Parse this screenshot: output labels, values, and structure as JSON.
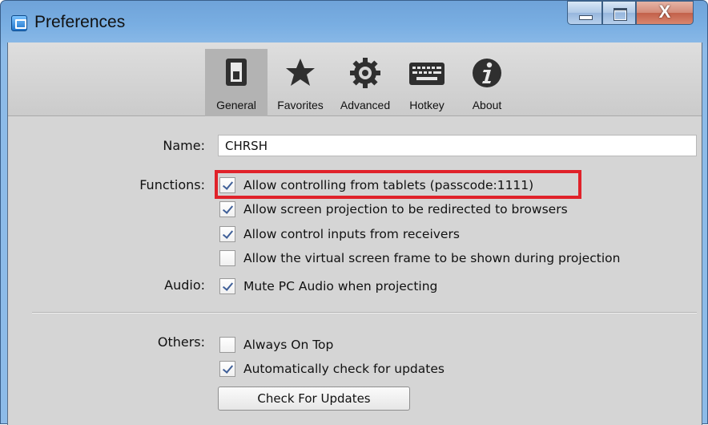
{
  "window": {
    "title": "Preferences",
    "close_glyph": "X"
  },
  "toolbar": {
    "items": [
      {
        "label": "General",
        "icon": "switch-icon",
        "active": true
      },
      {
        "label": "Favorites",
        "icon": "star-icon"
      },
      {
        "label": "Advanced",
        "icon": "gear-icon"
      },
      {
        "label": "Hotkey",
        "icon": "keyboard-icon"
      },
      {
        "label": "About",
        "icon": "info-icon"
      }
    ]
  },
  "general": {
    "name_label": "Name:",
    "name_value": "CHRSH",
    "functions_label": "Functions:",
    "functions": [
      {
        "label": "Allow controlling from tablets (passcode:1111)",
        "checked": true
      },
      {
        "label": "Allow screen projection to be redirected to browsers",
        "checked": true
      },
      {
        "label": "Allow control inputs from receivers",
        "checked": true
      },
      {
        "label": "Allow the virtual screen frame to be shown during projection",
        "checked": false
      }
    ],
    "audio_label": "Audio:",
    "audio": [
      {
        "label": "Mute PC Audio when projecting",
        "checked": true
      }
    ],
    "others_label": "Others:",
    "others": [
      {
        "label": "Always On Top",
        "checked": false
      },
      {
        "label": "Automatically check for updates",
        "checked": true
      }
    ],
    "check_updates_button": "Check For Updates"
  },
  "colors": {
    "highlight": "#e0222a",
    "title_bar": "#79aee2",
    "panel": "#d5d5d5"
  }
}
